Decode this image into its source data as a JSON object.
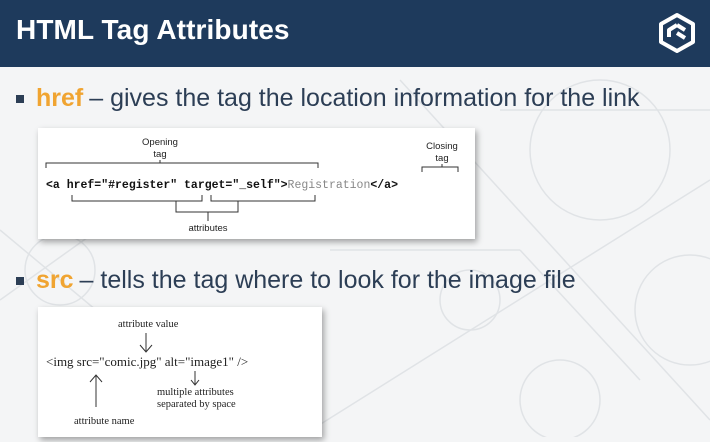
{
  "slide": {
    "title": "HTML Tag Attributes",
    "accent_color": "#f0a431",
    "header_color": "#1e3a5c",
    "logo_icon": "hexagon-brand-logo-icon"
  },
  "bullets": [
    {
      "keyword": "href",
      "text": "– gives the tag the location information for the link"
    },
    {
      "keyword": "src",
      "text": "– tells the tag where to look for the image file"
    }
  ],
  "href_diagram": {
    "label_opening": "Opening",
    "label_opening_2": "tag",
    "label_closing": "Closing",
    "label_closing_2": "tag",
    "code_open": "<a href=\"#register\" target=\"_self\">",
    "code_text": "Registration",
    "code_close": "</a>",
    "label_attributes": "attributes"
  },
  "src_diagram": {
    "label_value": "attribute value",
    "code": "<img src=\"comic.jpg\" alt=\"image1\" />",
    "label_multiple": "multiple attributes",
    "label_separated": "separated by space",
    "label_name": "attribute name"
  }
}
